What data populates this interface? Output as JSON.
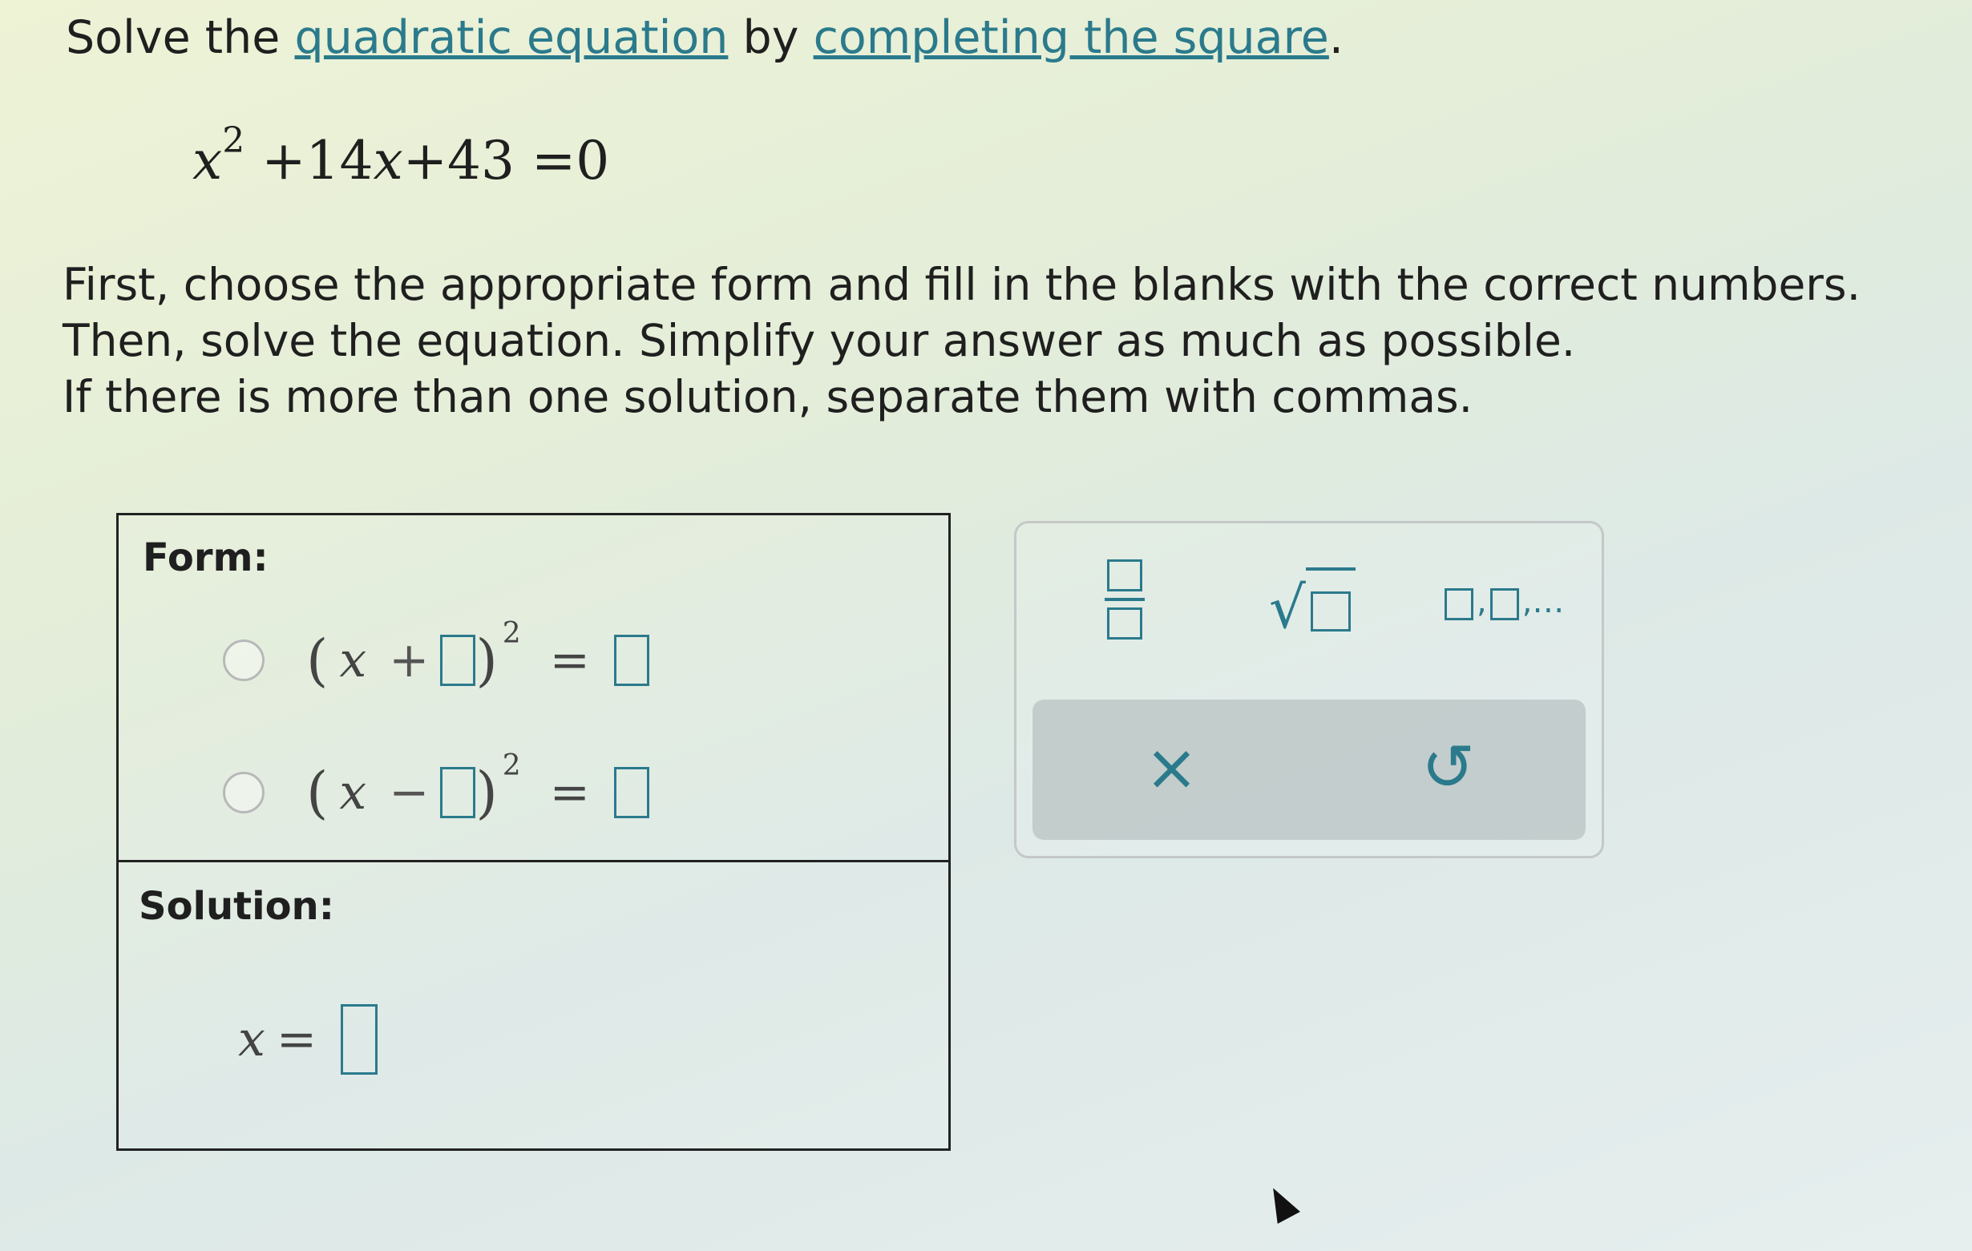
{
  "prompt": {
    "prefix": "Solve the ",
    "link1": "quadratic equation",
    "middle": " by ",
    "link2": "completing the square",
    "suffix": "."
  },
  "equation": {
    "var": "x",
    "exp": "2",
    "rest1": " +14",
    "var2": "x",
    "rest2": "+43 =0"
  },
  "instructions": [
    "First, choose the appropriate form and fill in the blanks with the correct numbers.",
    "Then, solve the equation. Simplify your answer as much as possible.",
    "If there is more than one solution, separate them with commas."
  ],
  "form": {
    "heading": "Form:",
    "option_plus": {
      "var": "x",
      "op": "+",
      "exp": "2",
      "eq": "="
    },
    "option_minus": {
      "var": "x",
      "op": "−",
      "exp": "2",
      "eq": "="
    }
  },
  "solution": {
    "heading": "Solution:",
    "var": "x",
    "eq": "="
  },
  "toolbar": {
    "list_label": ",…",
    "sqrt_symbol": "√",
    "clear_symbol": "×",
    "undo_symbol": "↺"
  },
  "colors": {
    "accent": "#2b7a8c",
    "action_bar": "#aab4b4"
  }
}
